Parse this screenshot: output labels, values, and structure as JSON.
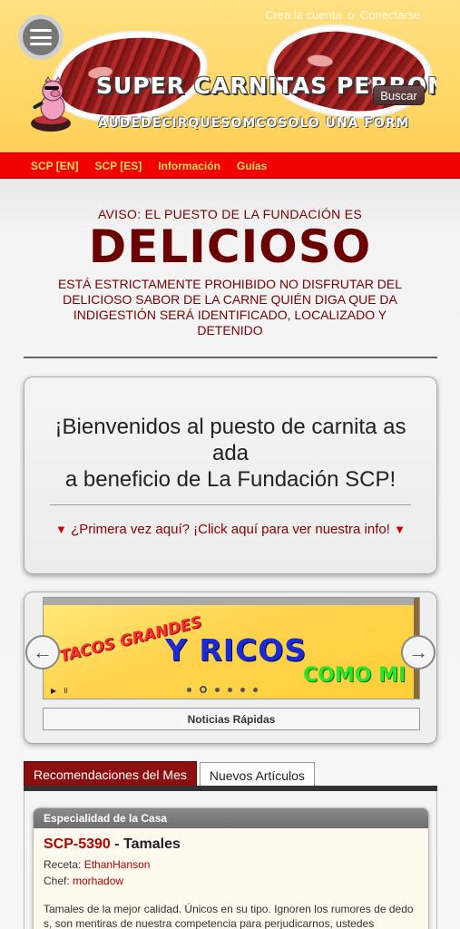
{
  "header": {
    "menu_icon": "hamburger-icon",
    "create_account": "Crea la cuenta",
    "separator": "o",
    "login": "Conectarse",
    "site_title": "SUPER CARNITAS PERRONA",
    "site_subtitle": "AUDEDECIRQUESOMCOSOLO UNA FORM",
    "search_label": "Buscar"
  },
  "nav": {
    "items": [
      "SCP [EN]",
      "SCP [ES]",
      "Información",
      "Guías"
    ]
  },
  "notice": {
    "line1": "AVISO: EL PUESTO DE LA FUNDACIÓN ES",
    "big": "DELICIOSO",
    "text": "ESTÁ ESTRICTAMENTE PROHIBIDO NO DISFRUTAR DEL DELICIOSO SABOR DE LA CARNE QUIÉN DIGA QUE DA INDIGESTIÓN SERÁ IDENTIFICADO, LOCALIZADO Y DETENIDO"
  },
  "welcome": {
    "title_line1": "¡Bienvenidos al puesto de carnita as",
    "title_line2": "ada",
    "title_line3": "a beneficio de La Fundación SCP!",
    "link": "¿Primera vez aquí? ¡Click aquí para ver nuestra info!",
    "tri_left": "▼",
    "tri_right": "▼"
  },
  "slider": {
    "slide_text1": "TACOS GRANDES",
    "slide_text2": "Y RICOS",
    "slide_text3": "COMO MI",
    "play": "▶",
    "pause": "II",
    "prev": "←",
    "next": "→",
    "caption": "Noticias Rápidas"
  },
  "tabs": {
    "items": [
      "Recomendaciones del Mes",
      "Nuevos Artículos"
    ]
  },
  "feature": {
    "header": "Especialidad de la Casa",
    "scp": "SCP-5390",
    "title_rest": " - Tamales",
    "recipe_label": "Receta: ",
    "recipe_author": "EthanHanson",
    "chef_label": "Chef: ",
    "chef": "morhadow",
    "description": "Tamales de la mejor calidad. Únicos en su tipo. Ignoren los rumores de dedos, son mentiras de nuestra competencia para perjudicarnos, ustedes"
  },
  "colors": {
    "header_bg": "#ffd96a",
    "nav_bg": "#f20000",
    "nav_text": "#ffde59",
    "notice_text": "#6b0000",
    "tab_active": "#8a1010",
    "link_red": "#b30000"
  }
}
